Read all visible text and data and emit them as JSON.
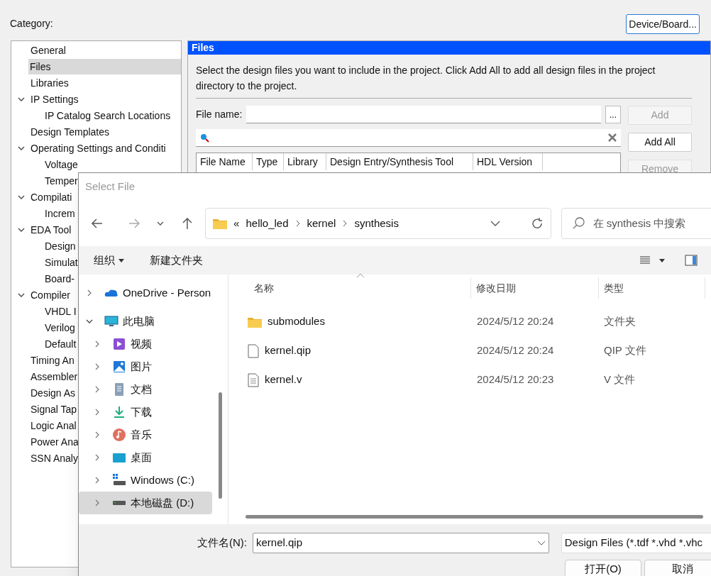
{
  "settings": {
    "category_label": "Category:",
    "device_button": "Device/Board...",
    "tree": [
      {
        "label": "General",
        "selected": false
      },
      {
        "label": "Files",
        "selected": true
      },
      {
        "label": "Libraries",
        "selected": false
      },
      {
        "label": "IP Settings",
        "selected": false,
        "expanded": true,
        "children": [
          {
            "label": "IP Catalog Search Locations",
            "selected": false
          }
        ]
      },
      {
        "label": "Design Templates",
        "selected": false
      },
      {
        "label": "Operating Settings and Conditi",
        "selected": false,
        "expanded": true,
        "children": [
          {
            "label": "Voltage",
            "selected": false
          },
          {
            "label": "Temper",
            "selected": false
          }
        ]
      },
      {
        "label": "Compilati",
        "selected": false,
        "expanded": true,
        "children": [
          {
            "label": "Increm",
            "selected": false
          }
        ]
      },
      {
        "label": "EDA Tool",
        "selected": false,
        "expanded": true,
        "children": [
          {
            "label": "Design",
            "selected": false
          },
          {
            "label": "Simulat",
            "selected": false
          },
          {
            "label": "Board-",
            "selected": false
          }
        ]
      },
      {
        "label": "Compiler",
        "selected": false,
        "expanded": true,
        "children": [
          {
            "label": "VHDL I",
            "selected": false
          },
          {
            "label": "Verilog",
            "selected": false
          },
          {
            "label": "Default",
            "selected": false
          }
        ]
      },
      {
        "label": "Timing An",
        "selected": false
      },
      {
        "label": "Assembler",
        "selected": false
      },
      {
        "label": "Design As",
        "selected": false
      },
      {
        "label": "Signal Tap",
        "selected": false
      },
      {
        "label": "Logic Anal",
        "selected": false
      },
      {
        "label": "Power Ana",
        "selected": false
      },
      {
        "label": "SSN Analy",
        "selected": false
      }
    ],
    "panel": {
      "title": "Files",
      "description": "Select the design files you want to include in the project. Click Add All to add all design files in the project directory to the project.",
      "file_name_label": "File name:",
      "browse_button": "...",
      "buttons": [
        {
          "label": "Add",
          "disabled": true
        },
        {
          "label": "Add All",
          "disabled": false
        },
        {
          "label": "Remove",
          "disabled": true
        }
      ],
      "table_columns": [
        "File Name",
        "Type",
        "Library",
        "Design Entry/Synthesis Tool",
        "HDL Version"
      ]
    }
  },
  "dialog": {
    "title": "Select File",
    "path_overflow": "«",
    "path": [
      "hello_led",
      "kernel",
      "synthesis"
    ],
    "search_placeholder": "在 synthesis 中搜索",
    "toolbar": {
      "organize": "组织",
      "new_folder": "新建文件夹"
    },
    "nav": [
      {
        "label": "OneDrive - Person",
        "kind": "cloud",
        "expanded": false,
        "selected": false
      },
      {
        "label": "此电脑",
        "kind": "pc",
        "expanded": true,
        "selected": false,
        "children": [
          {
            "label": "视频",
            "kind": "video",
            "expanded": false,
            "selected": false
          },
          {
            "label": "图片",
            "kind": "pictures",
            "expanded": false,
            "selected": false
          },
          {
            "label": "文档",
            "kind": "documents",
            "expanded": false,
            "selected": false
          },
          {
            "label": "下载",
            "kind": "downloads",
            "expanded": false,
            "selected": false
          },
          {
            "label": "音乐",
            "kind": "music",
            "expanded": false,
            "selected": false
          },
          {
            "label": "桌面",
            "kind": "desktop",
            "expanded": false,
            "selected": false
          },
          {
            "label": "Windows (C:)",
            "kind": "system-drive",
            "expanded": false,
            "selected": false
          },
          {
            "label": "本地磁盘 (D:)",
            "kind": "drive",
            "expanded": false,
            "selected": true
          }
        ]
      }
    ],
    "columns": [
      "名称",
      "修改日期",
      "类型"
    ],
    "files": [
      {
        "name": "submodules",
        "kind": "folder",
        "date": "2024/5/12 20:24",
        "type": "文件夹"
      },
      {
        "name": "kernel.qip",
        "kind": "file",
        "date": "2024/5/12 20:24",
        "type": "QIP 文件"
      },
      {
        "name": "kernel.v",
        "kind": "text",
        "date": "2024/5/12 20:23",
        "type": "V 文件"
      }
    ],
    "file_name_label": "文件名(N):",
    "file_name": "kernel.qip",
    "filter": "Design Files (*.tdf *.vhd *.vhc",
    "buttons": [
      "打开(O)",
      "取消"
    ]
  }
}
